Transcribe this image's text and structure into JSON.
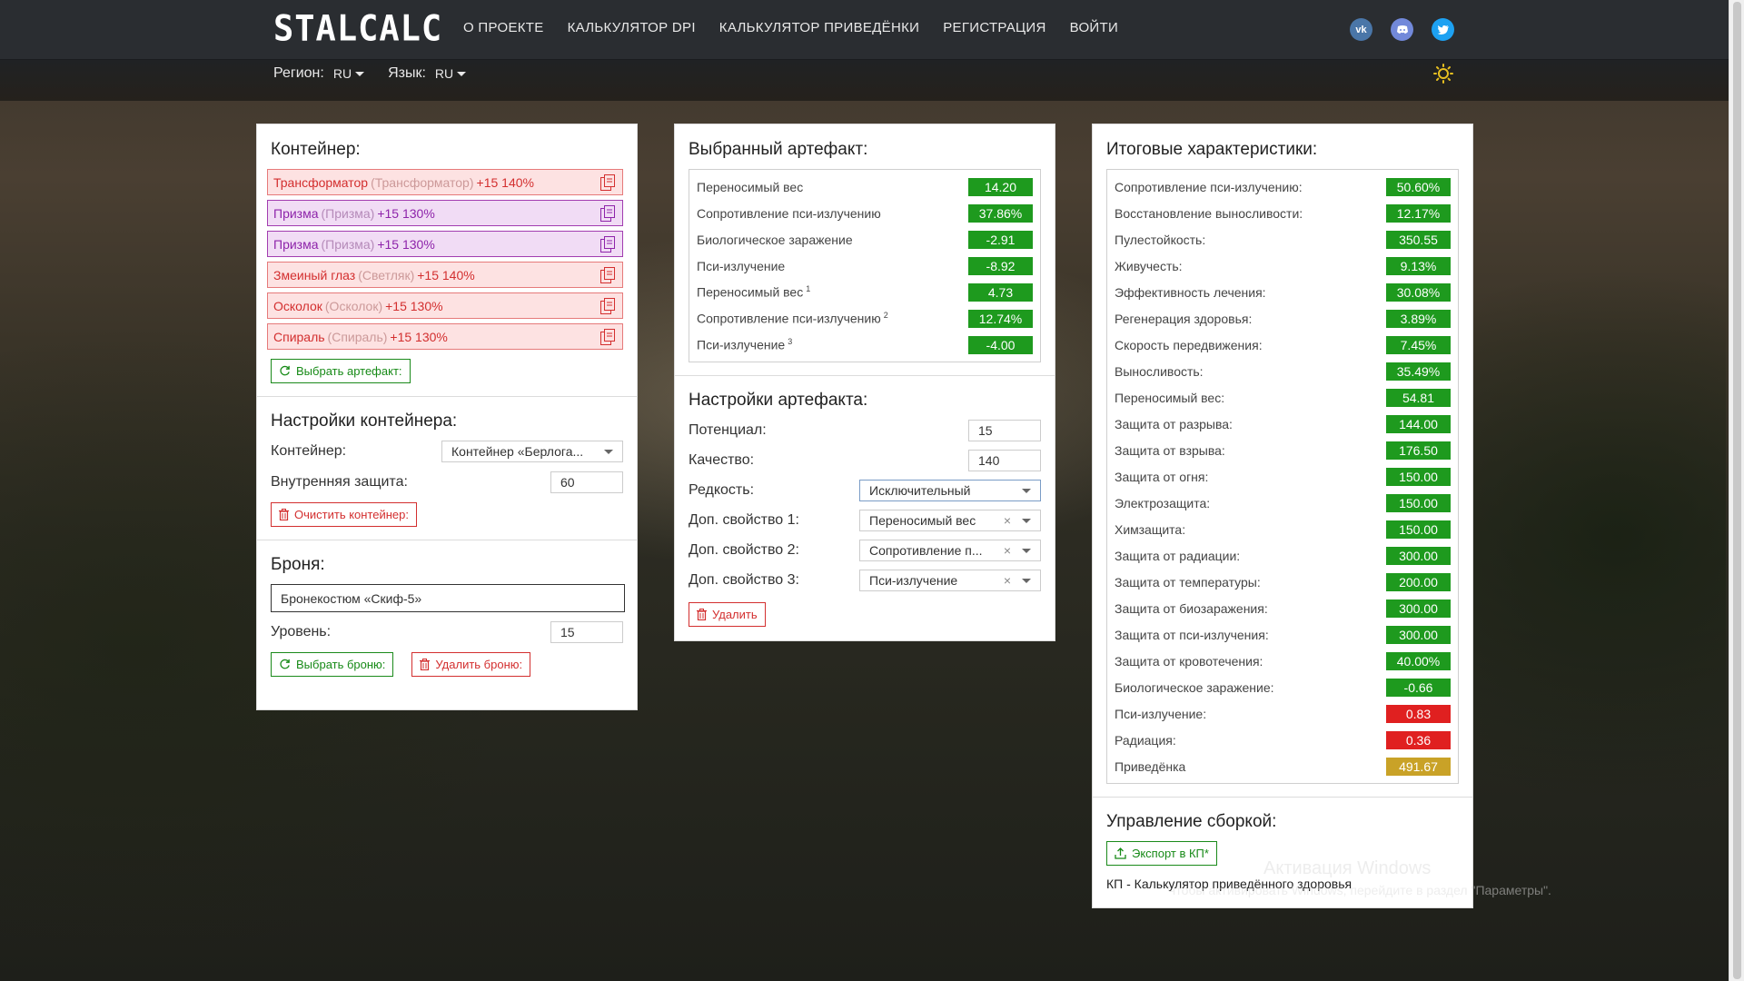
{
  "nav": {
    "logo": "STALCALC",
    "links": [
      "О ПРОЕКТЕ",
      "КАЛЬКУЛЯТОР DPI",
      "КАЛЬКУЛЯТОР ПРИВЕДЁНКИ",
      "РЕГИСТРАЦИЯ",
      "ВОЙТИ"
    ],
    "socials": [
      "vk-icon",
      "discord-icon",
      "twitter-icon"
    ]
  },
  "subbar": {
    "region_label": "Регион:",
    "region_value": "RU",
    "lang_label": "Язык:",
    "lang_value": "RU"
  },
  "container": {
    "title": "Контейнер:",
    "artifacts": [
      {
        "name": "Трансформатор",
        "orig": "(Трансформатор)",
        "level": "+15 140%",
        "style": "red"
      },
      {
        "name": "Призма",
        "orig": "(Призма)",
        "level": "+15 130%",
        "style": "purple"
      },
      {
        "name": "Призма",
        "orig": "(Призма)",
        "level": "+15 130%",
        "style": "purple"
      },
      {
        "name": "Змеиный глаз",
        "orig": "(Светляк)",
        "level": "+15 140%",
        "style": "red"
      },
      {
        "name": "Осколок",
        "orig": "(Осколок)",
        "level": "+15 130%",
        "style": "red"
      },
      {
        "name": "Спираль",
        "orig": "(Спираль)",
        "level": "+15 130%",
        "style": "red"
      }
    ],
    "select_btn": "Выбрать артефакт:"
  },
  "container_settings": {
    "title": "Настройки контейнера:",
    "container_label": "Контейнер:",
    "container_value": "Контейнер «Берлога...",
    "protection_label": "Внутренняя защита:",
    "protection_value": "60",
    "clear_btn": "Очистить контейнер:"
  },
  "armor": {
    "title": "Броня:",
    "armor_value": "Бронекостюм «Скиф-5»",
    "level_label": "Уровень:",
    "level_value": "15",
    "select_btn": "Выбрать броню:",
    "delete_btn": "Удалить броню:"
  },
  "selected_artifact": {
    "title": "Выбранный артефакт:",
    "stats": [
      {
        "label": "Переносимый вес",
        "sup": "",
        "value": "14.20",
        "color": "g"
      },
      {
        "label": "Сопротивление пси-излучению",
        "sup": "",
        "value": "37.86%",
        "color": "g"
      },
      {
        "label": "Биологическое заражение",
        "sup": "",
        "value": "-2.91",
        "color": "g"
      },
      {
        "label": "Пси-излучение",
        "sup": "",
        "value": "-8.92",
        "color": "g"
      },
      {
        "label": "Переносимый вес",
        "sup": "1",
        "value": "4.73",
        "color": "g"
      },
      {
        "label": "Сопротивление пси-излучению",
        "sup": "2",
        "value": "12.74%",
        "color": "g"
      },
      {
        "label": "Пси-излучение",
        "sup": "3",
        "value": "-4.00",
        "color": "g"
      }
    ]
  },
  "artifact_settings": {
    "title": "Настройки артефакта:",
    "potential_label": "Потенциал:",
    "potential_value": "15",
    "quality_label": "Качество:",
    "quality_value": "140",
    "rarity_label": "Редкость:",
    "rarity_value": "Исключительный",
    "prop1_label": "Доп. свойство 1:",
    "prop1_value": "Переносимый вес",
    "prop2_label": "Доп. свойство 2:",
    "prop2_value": "Сопротивление п...",
    "prop3_label": "Доп. свойство 3:",
    "prop3_value": "Пси-излучение",
    "delete_btn": "Удалить"
  },
  "totals": {
    "title": "Итоговые характеристики:",
    "stats": [
      {
        "label": "Сопротивление пси-излучению:",
        "value": "50.60%",
        "color": "g"
      },
      {
        "label": "Восстановление выносливости:",
        "value": "12.17%",
        "color": "g"
      },
      {
        "label": "Пулестойкость:",
        "value": "350.55",
        "color": "g"
      },
      {
        "label": "Живучесть:",
        "value": "9.13%",
        "color": "g"
      },
      {
        "label": "Эффективность лечения:",
        "value": "30.08%",
        "color": "g"
      },
      {
        "label": "Регенерация здоровья:",
        "value": "3.89%",
        "color": "g"
      },
      {
        "label": "Скорость передвижения:",
        "value": "7.45%",
        "color": "g"
      },
      {
        "label": "Выносливость:",
        "value": "35.49%",
        "color": "g"
      },
      {
        "label": "Переносимый вес:",
        "value": "54.81",
        "color": "g"
      },
      {
        "label": "Защита от разрыва:",
        "value": "144.00",
        "color": "g"
      },
      {
        "label": "Защита от взрыва:",
        "value": "176.50",
        "color": "g"
      },
      {
        "label": "Защита от огня:",
        "value": "150.00",
        "color": "g"
      },
      {
        "label": "Электрозащита:",
        "value": "150.00",
        "color": "g"
      },
      {
        "label": "Химзащита:",
        "value": "150.00",
        "color": "g"
      },
      {
        "label": "Защита от радиации:",
        "value": "300.00",
        "color": "g"
      },
      {
        "label": "Защита от температуры:",
        "value": "200.00",
        "color": "g"
      },
      {
        "label": "Защита от биозаражения:",
        "value": "300.00",
        "color": "g"
      },
      {
        "label": "Защита от пси-излучения:",
        "value": "300.00",
        "color": "g"
      },
      {
        "label": "Защита от кровотечения:",
        "value": "40.00%",
        "color": "g"
      },
      {
        "label": "Биологическое заражение:",
        "value": "-0.66",
        "color": "g"
      },
      {
        "label": "Пси-излучение:",
        "value": "0.83",
        "color": "r"
      },
      {
        "label": "Радиация:",
        "value": "0.36",
        "color": "r"
      },
      {
        "label": "Приведёнка",
        "value": "491.67",
        "color": "y"
      }
    ]
  },
  "build": {
    "title": "Управление сборкой:",
    "export_btn": "Экспорт в КП*",
    "note": "КП - Калькулятор приведённого здоровья"
  },
  "watermark": {
    "line1": "Активация Windows",
    "line2": "Чтобы активировать Windows, перейдите в раздел \"Параметры\"."
  },
  "colors": {
    "green": "#1e9a1e",
    "red": "#e02020",
    "gold": "#c9a227",
    "navbar": "#2a2d31"
  }
}
